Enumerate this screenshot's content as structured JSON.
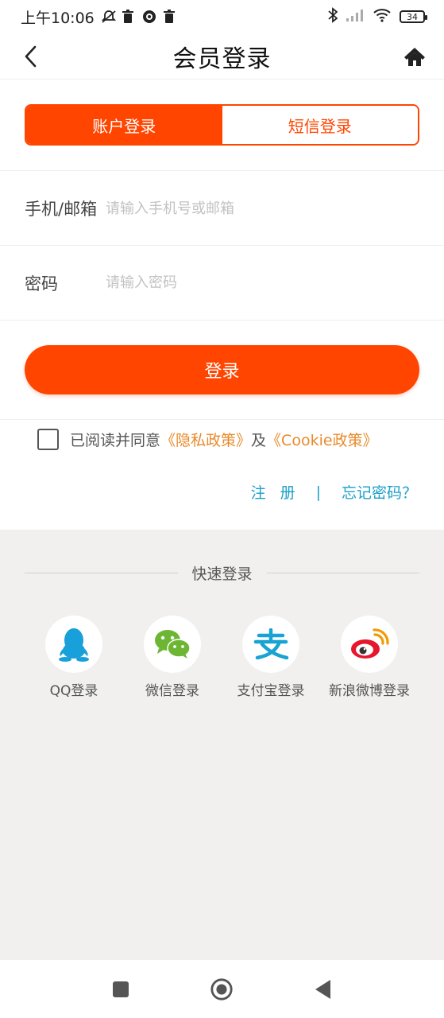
{
  "status_bar": {
    "time": "上午10:06",
    "battery": "34"
  },
  "header": {
    "title": "会员登录"
  },
  "tabs": [
    {
      "label": "账户登录",
      "active": true
    },
    {
      "label": "短信登录",
      "active": false
    }
  ],
  "form": {
    "account_label": "手机/邮箱",
    "account_placeholder": "请输入手机号或邮箱",
    "password_label": "密码",
    "password_placeholder": "请输入密码"
  },
  "login_button": "登录",
  "agreement": {
    "prefix": "已阅读并同意",
    "privacy_link": "《隐私政策》",
    "and": "及",
    "cookie_link": "《Cookie政策》"
  },
  "links": {
    "register": "注册",
    "divider": "|",
    "forgot": "忘记密码？"
  },
  "quick_login": {
    "title": "快速登录",
    "items": [
      {
        "label": "QQ登录",
        "icon": "qq-icon"
      },
      {
        "label": "微信登录",
        "icon": "wechat-icon"
      },
      {
        "label": "支付宝登录",
        "icon": "alipay-icon"
      },
      {
        "label": "新浪微博登录",
        "icon": "weibo-icon"
      }
    ]
  },
  "colors": {
    "accent": "#ff4500",
    "link_orange": "#e88a2a",
    "link_blue": "#1aa0c8",
    "quick_bg": "#f1f0ef"
  }
}
